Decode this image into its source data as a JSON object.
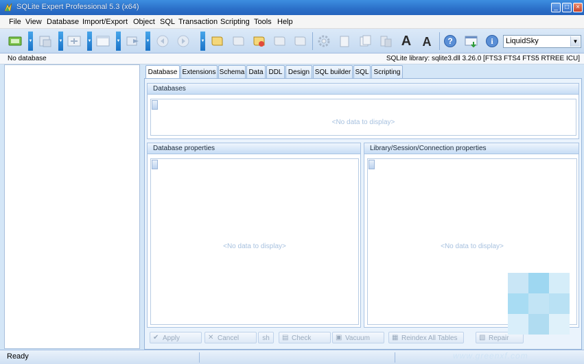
{
  "window": {
    "title": "SQLite Expert Professional 5.3 (x64)",
    "minimize": "_",
    "maximize": "□",
    "close": "×"
  },
  "menu": [
    "File",
    "View",
    "Database",
    "Import/Export",
    "Object",
    "SQL",
    "Transaction",
    "Scripting",
    "Tools",
    "Help"
  ],
  "toolbar": {
    "theme_value": "LiquidSky",
    "font_increase": "A",
    "font_decrease": "A"
  },
  "infobar": {
    "status": "No database",
    "library": "SQLite library: sqlite3.dll 3.26.0 [FTS3 FTS4 FTS5 RTREE ICU]"
  },
  "tabs": [
    "Database",
    "Extensions",
    "Schema",
    "Data",
    "DDL",
    "Design",
    "SQL builder",
    "SQL",
    "Scripting"
  ],
  "panels": {
    "databases": {
      "title": "Databases",
      "empty": "<No data to display>"
    },
    "db_properties": {
      "title": "Database properties",
      "empty": "<No data to display>"
    },
    "lib_properties": {
      "title": "Library/Session/Connection properties",
      "empty": "<No data to display>"
    }
  },
  "actions": {
    "apply": "Apply",
    "cancel": "Cancel",
    "refresh": "sh",
    "check": "Check",
    "vacuum": "Vacuum",
    "reindex": "Reindex All Tables",
    "repair": "Repair"
  },
  "status": {
    "text": "Ready"
  },
  "watermark": {
    "text": "www.greenxf.com"
  },
  "colors": {
    "accent": "#2b6fc8",
    "panel_header": "#c7ddf5",
    "disabled_text": "#9aaabd"
  }
}
